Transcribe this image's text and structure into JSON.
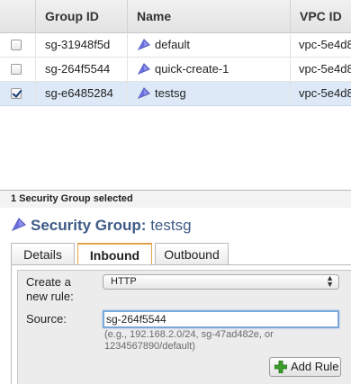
{
  "table": {
    "columns": [
      "Group ID",
      "Name",
      "VPC ID"
    ],
    "rows": [
      {
        "group_id": "sg-31948f5d",
        "name": "default",
        "vpc_id": "vpc-5e4d8",
        "checked": false
      },
      {
        "group_id": "sg-264f5544",
        "name": "quick-create-1",
        "vpc_id": "vpc-5e4d8",
        "checked": false
      },
      {
        "group_id": "sg-e6485284",
        "name": "testsg",
        "vpc_id": "vpc-5e4d8",
        "checked": true
      }
    ]
  },
  "details": {
    "selection_status": "1 Security Group selected",
    "title_label": "Security Group:",
    "title_name": "testsg",
    "tabs": [
      {
        "label": "Details",
        "active": false
      },
      {
        "label": "Inbound",
        "active": true
      },
      {
        "label": "Outbound",
        "active": false
      }
    ],
    "form": {
      "create_label_line1": "Create a",
      "create_label_line2": "new rule:",
      "rule_type_value": "HTTP",
      "source_label": "Source:",
      "source_value": "sg-264f5544",
      "source_hint": "(e.g., 192.168.2.0/24, sg-47ad482e, or 1234567890/default)",
      "add_rule_label": "Add Rule"
    }
  },
  "icons": {
    "security_group": "security-group-icon",
    "add": "plus-icon",
    "select_arrows": "select-arrows-icon",
    "checkbox_checked": "checkbox-checked-icon"
  },
  "colors": {
    "selected_row": "#dde9f7",
    "title": "#3d5a86",
    "active_tab_accent": "#e4a34a",
    "plus_green": "#3aa02a"
  }
}
